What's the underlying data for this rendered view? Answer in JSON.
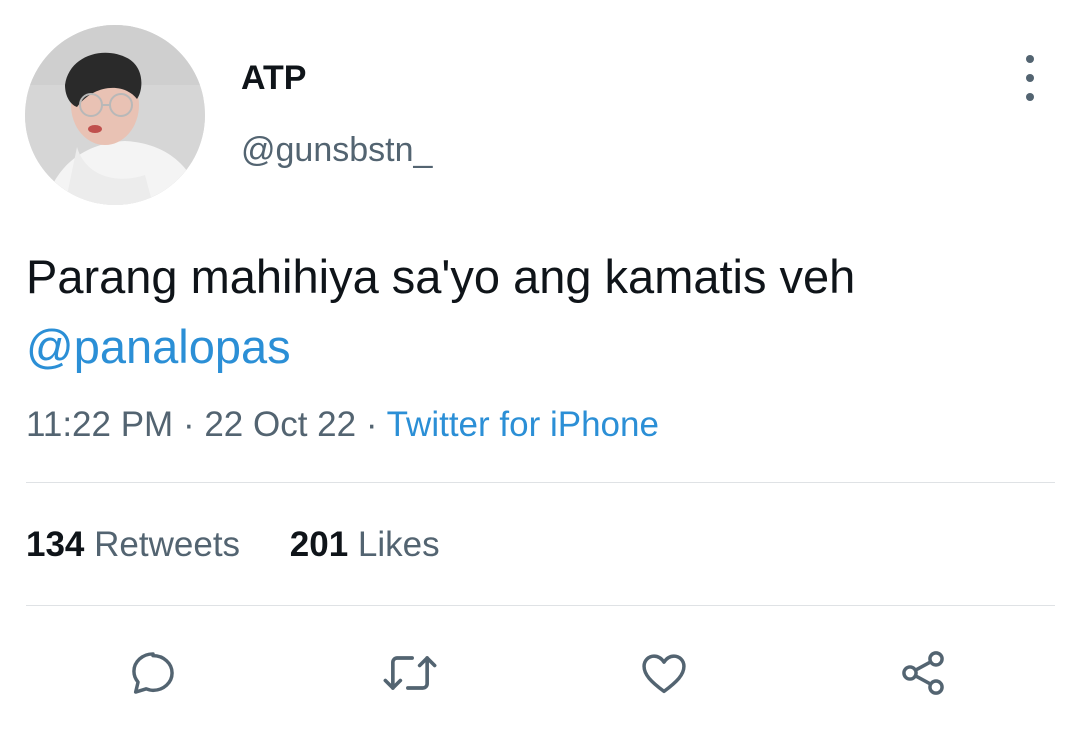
{
  "user": {
    "display_name": "ATP",
    "handle": "@gunsbstn_",
    "avatar": "profile-photo"
  },
  "more_icon": "vertical-dots-icon",
  "tweet": {
    "text": "Parang mahihiya sa'yo ang kamatis veh",
    "mention": "@panalopas",
    "time": "11:22 PM",
    "separator": "·",
    "date": "22 Oct 22",
    "source": "Twitter for iPhone"
  },
  "stats": {
    "retweets_count": "134",
    "retweets_label": "Retweets",
    "likes_count": "201",
    "likes_label": "Likes"
  },
  "actions": [
    {
      "icon": "reply-icon"
    },
    {
      "icon": "retweet-icon"
    },
    {
      "icon": "like-icon"
    },
    {
      "icon": "share-icon"
    }
  ],
  "colors": {
    "link": "#2b8fd6",
    "secondary_text": "#536471",
    "primary_text": "#0f1419"
  }
}
